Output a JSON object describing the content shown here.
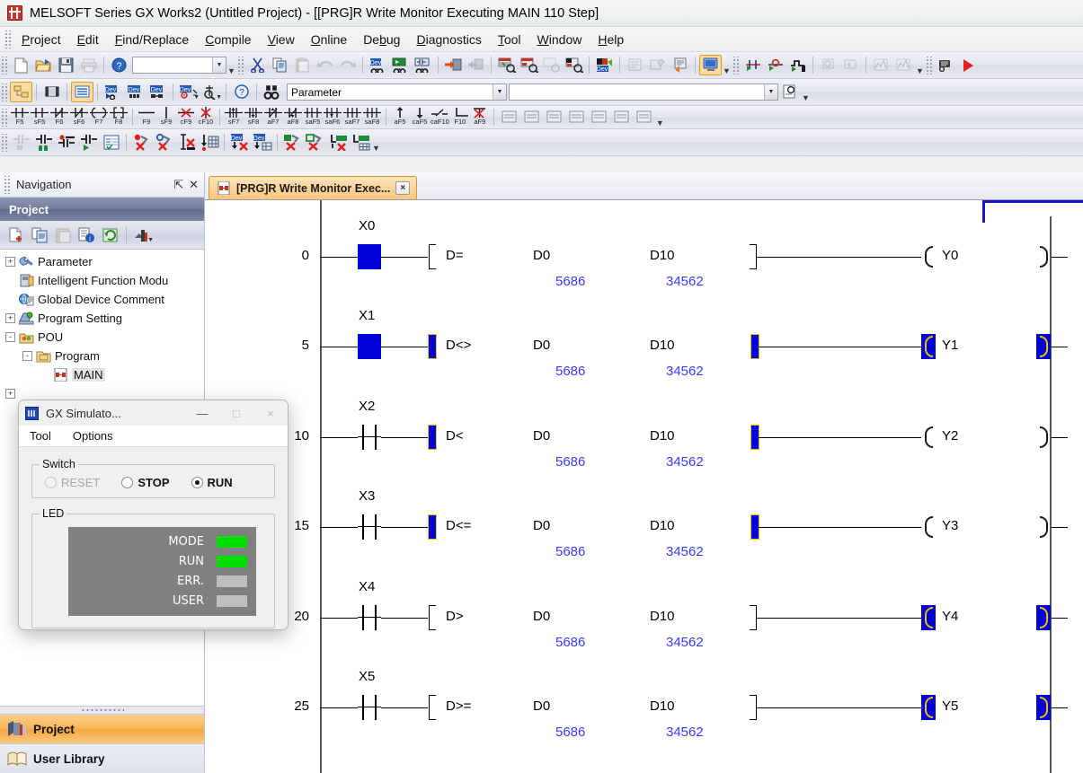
{
  "window": {
    "title": "MELSOFT Series GX Works2 (Untitled Project) - [[PRG]R Write Monitor Executing MAIN 110 Step]",
    "app_icon": "melsoft-logo-icon"
  },
  "menubar": {
    "items": [
      {
        "label": "Project",
        "accel": "P"
      },
      {
        "label": "Edit",
        "accel": "E"
      },
      {
        "label": "Find/Replace",
        "accel": "F"
      },
      {
        "label": "Compile",
        "accel": "C"
      },
      {
        "label": "View",
        "accel": "V"
      },
      {
        "label": "Online",
        "accel": "O"
      },
      {
        "label": "Debug",
        "accel": "b"
      },
      {
        "label": "Diagnostics",
        "accel": "D"
      },
      {
        "label": "Tool",
        "accel": "T"
      },
      {
        "label": "Window",
        "accel": "W"
      },
      {
        "label": "Help",
        "accel": "H"
      }
    ]
  },
  "toolbars": {
    "standard": {
      "buttons": [
        "new-icon",
        "open-icon",
        "save-icon",
        "print-icon",
        "help-icon"
      ],
      "combo_value": "",
      "combo_placeholder": ""
    },
    "edit": {
      "buttons": [
        "cut-icon",
        "copy-icon",
        "paste-icon",
        "undo-icon",
        "redo-icon",
        "find-device-icon",
        "find-instruction-icon",
        "find-contact-coil-icon",
        "device-replace-icon",
        "change-contact-coil-icon",
        "cross-reference-icon",
        "device-list-icon",
        "search-device-icon",
        "device-batch-replace-icon",
        "device-monitor-icon"
      ]
    },
    "program": {
      "buttons": [
        "comment-icon",
        "statement-icon",
        "note-icon",
        "monitor-mode-icon"
      ]
    },
    "debug": {
      "buttons": [
        "step-execution-icon",
        "breakpoint-icon",
        "skip-execution-icon",
        "watch-icon",
        "scan-execution-icon",
        "sampling-trace-icon",
        "trace-result-icon"
      ]
    },
    "sim": {
      "buttons": [
        "simulation-start-icon",
        "run-icon"
      ]
    },
    "view": {
      "buttons": [
        "project-tree-icon",
        "docking-window-icon",
        "ladder-view-icon",
        "device-find-icon",
        "device-list-view-icon",
        "device-compare-icon",
        "device-monitor-view-icon",
        "zoom-monitor-icon",
        "help-question-icon",
        "binocular-icon"
      ],
      "combo1_value": "Parameter",
      "combo2_value": ""
    },
    "ladder_keys": [
      {
        "glyph": "-| |-",
        "caption": "F5"
      },
      {
        "glyph": "-| |-2",
        "caption": "sF5"
      },
      {
        "glyph": "-|/|-",
        "caption": "F6"
      },
      {
        "glyph": "-|/|-2",
        "caption": "sF6"
      },
      {
        "glyph": "-( )-",
        "caption": "F7"
      },
      {
        "glyph": "-[ ]-",
        "caption": "F8"
      },
      {
        "glyph": "----",
        "caption": "F9"
      },
      {
        "glyph": "|",
        "caption": "sF9"
      },
      {
        "glyph": "-x-",
        "caption": "cF9"
      },
      {
        "glyph": "|x",
        "caption": "cF10"
      },
      {
        "glyph": "-|↑|-",
        "caption": "sF7"
      },
      {
        "glyph": "-|↓|-",
        "caption": "sF8"
      },
      {
        "glyph": "-|/↑|-",
        "caption": "aF7"
      },
      {
        "glyph": "-|/↓|-",
        "caption": "aF8"
      },
      {
        "glyph": "-|↑↑|-",
        "caption": "saF5"
      },
      {
        "glyph": "-|↓↓|-",
        "caption": "saF6"
      },
      {
        "glyph": "-(↑)-",
        "caption": "saF7"
      },
      {
        "glyph": "-(↓)-",
        "caption": "saF8"
      },
      {
        "glyph": "↑",
        "caption": "aF5"
      },
      {
        "glyph": "↓",
        "caption": "caF5"
      },
      {
        "glyph": "-/-",
        "caption": "caF10"
      },
      {
        "glyph": "L_",
        "caption": "F10"
      },
      {
        "glyph": "x",
        "caption": "aF9"
      }
    ],
    "ladder_keys_tail": [
      "st-block-icon",
      "edit-line-icon",
      "insert-row-icon",
      "delete-row-icon",
      "insert-column-icon",
      "delete-column-icon",
      "list-view-icon"
    ],
    "monitor_row": [
      "monitor-write-icon",
      "monitor-start-icon",
      "monitor-stop-icon",
      "monitor-run-icon",
      "check-program-icon",
      "device-test-red-icon",
      "device-test-blue-icon",
      "device-batch-icon",
      "entry-data-monitor-icon",
      "dev-write-icon",
      "dev-read-icon",
      "plc-write-icon",
      "plc-read-icon",
      "local-write-icon",
      "local-read-icon"
    ]
  },
  "navigation": {
    "title": "Navigation",
    "pin_icon": "pin-icon",
    "close_icon": "close-icon",
    "section_title": "Project",
    "tool_icons": [
      "new-data-icon",
      "copy-data-icon",
      "paste-data-icon",
      "data-property-icon",
      "refresh-icon",
      "view-mode-icon"
    ],
    "tree": [
      {
        "label": "Parameter",
        "indent": 0,
        "expander": "+",
        "icon": "parameter-icon"
      },
      {
        "label": "Intelligent Function Modu",
        "indent": 0,
        "expander": "",
        "icon": "intelligent-module-icon"
      },
      {
        "label": "Global Device Comment",
        "indent": 0,
        "expander": "",
        "icon": "global-comment-icon"
      },
      {
        "label": "Program Setting",
        "indent": 0,
        "expander": "+",
        "icon": "program-setting-icon"
      },
      {
        "label": "POU",
        "indent": 0,
        "expander": "-",
        "icon": "pou-icon"
      },
      {
        "label": "Program",
        "indent": 1,
        "expander": "-",
        "icon": "program-folder-icon"
      },
      {
        "label": "MAIN",
        "indent": 2,
        "expander": "",
        "icon": "ladder-program-icon",
        "selected": true
      },
      {
        "label": "",
        "indent": 0,
        "expander": "+",
        "icon": ""
      }
    ],
    "buttons": [
      {
        "label": "Project",
        "icon": "project-icon",
        "active": true
      },
      {
        "label": "User Library",
        "icon": "user-library-icon",
        "active": false
      }
    ]
  },
  "editor": {
    "tab": {
      "label": "[PRG]R Write Monitor Exec...",
      "icon": "ladder-program-icon",
      "close": "×"
    }
  },
  "ladder": {
    "device_labels": {
      "operand1": "D0",
      "operand2": "D10"
    },
    "values": {
      "operand1": "5686",
      "operand2": "34562"
    },
    "rungs": [
      {
        "step": "0",
        "contact": "X0",
        "contact_on": true,
        "instruction": "D=",
        "op1": "D0",
        "val1": "5686",
        "op2": "D10",
        "val2": "34562",
        "result_on": false,
        "coil": "Y0",
        "coil_on": false
      },
      {
        "step": "5",
        "contact": "X1",
        "contact_on": true,
        "instruction": "D<>",
        "op1": "D0",
        "val1": "5686",
        "op2": "D10",
        "val2": "34562",
        "result_on": true,
        "coil": "Y1",
        "coil_on": true
      },
      {
        "step": "10",
        "contact": "X2",
        "contact_on": false,
        "instruction": "D<",
        "op1": "D0",
        "val1": "5686",
        "op2": "D10",
        "val2": "34562",
        "result_on": true,
        "coil": "Y2",
        "coil_on": false
      },
      {
        "step": "15",
        "contact": "X3",
        "contact_on": false,
        "instruction": "D<=",
        "op1": "D0",
        "val1": "5686",
        "op2": "D10",
        "val2": "34562",
        "result_on": true,
        "coil": "Y3",
        "coil_on": false
      },
      {
        "step": "20",
        "contact": "X4",
        "contact_on": false,
        "instruction": "D>",
        "op1": "D0",
        "val1": "5686",
        "op2": "D10",
        "val2": "34562",
        "result_on": false,
        "coil": "Y4",
        "coil_on": true
      },
      {
        "step": "25",
        "contact": "X5",
        "contact_on": false,
        "instruction": "D>=",
        "op1": "D0",
        "val1": "5686",
        "op2": "D10",
        "val2": "34562",
        "result_on": false,
        "coil": "Y5",
        "coil_on": true
      }
    ],
    "right_coils": [
      {
        "on": false
      },
      {
        "on": true
      },
      {
        "on": false
      },
      {
        "on": false
      },
      {
        "on": true
      },
      {
        "on": true
      }
    ]
  },
  "simulator": {
    "title": "GX Simulato...",
    "icon": "gx-simulator-icon",
    "window_buttons": {
      "minimize": "—",
      "maximize": "□",
      "close": "×"
    },
    "menu": [
      "Tool",
      "Options"
    ],
    "switch": {
      "legend": "Switch",
      "options": [
        {
          "label": "RESET",
          "checked": false,
          "disabled": true
        },
        {
          "label": "STOP",
          "checked": false,
          "disabled": false
        },
        {
          "label": "RUN",
          "checked": true,
          "disabled": false
        }
      ]
    },
    "led": {
      "legend": "LED",
      "items": [
        {
          "label": "MODE",
          "color": "#00e000",
          "state": "on"
        },
        {
          "label": "RUN",
          "color": "#00e000",
          "state": "on"
        },
        {
          "label": "ERR.",
          "color": "#bfbfbf",
          "state": "off"
        },
        {
          "label": "USER",
          "color": "#bfbfbf",
          "state": "off"
        }
      ]
    }
  },
  "colors": {
    "energized": "#0000d8",
    "value_text": "#3a3aff",
    "coil_highlight": "#e8c100",
    "tab_active": "#f9c87f",
    "nav_active": "#f5a63f",
    "led_on": "#00e000",
    "led_off": "#bfbfbf"
  }
}
